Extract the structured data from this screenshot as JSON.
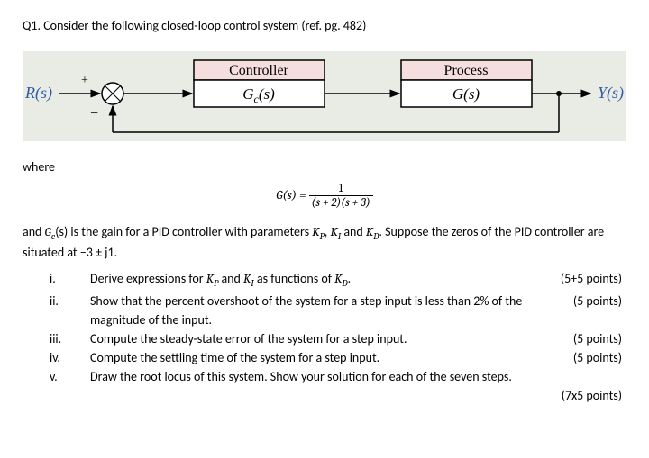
{
  "title": "Q1. Consider the following closed-loop control system (ref. pg. 482)",
  "diagram": {
    "input": "R(s)",
    "output": "Y(s)",
    "plus": "+",
    "minus": "−",
    "controller_label": "Controller",
    "controller_fn_pre": "G",
    "controller_fn_sub": "c",
    "controller_fn_post": "(s)",
    "process_label": "Process",
    "process_fn_pre": "G",
    "process_fn_post": "(s)"
  },
  "where": "where",
  "formula": {
    "lhs": "G(s) = ",
    "num": "1",
    "den": "(s + 2)(s + 3)"
  },
  "body1_a": "and ",
  "body1_b": "(s) is the gain for a PID controller with parameters ",
  "body1_c": ", ",
  "body1_d": " and ",
  "body1_e": ". Suppose the zeros of the PID controller are situated at −3 ± j1.",
  "Gc_G": "G",
  "Gc_c": "c",
  "Kp_K": "K",
  "Kp_p": "P",
  "Ki_K": "K",
  "Ki_i": "I",
  "Kd_K": "K",
  "Kd_d": "D",
  "items": {
    "i": {
      "n": "i.",
      "t_a": "Derive expressions for ",
      "t_b": " and ",
      "t_c": " as functions of ",
      "t_d": ".",
      "pts": "(5+5 points)"
    },
    "ii": {
      "n": "ii.",
      "t": "Show that the percent overshoot of the system for a step input is less than 2% of the magnitude of the input.",
      "pts": "(5 points)"
    },
    "iii": {
      "n": "iii.",
      "t": "Compute the steady-state error of the system for a step input.",
      "pts": "(5 points)"
    },
    "iv": {
      "n": "iv.",
      "t": "Compute the settling time of the system for a step input.",
      "pts": "(5 points)"
    },
    "v": {
      "n": "v.",
      "t": "Draw the root locus of this system. Show your solution for each of the seven steps.",
      "pts": "(7x5 points)"
    }
  }
}
